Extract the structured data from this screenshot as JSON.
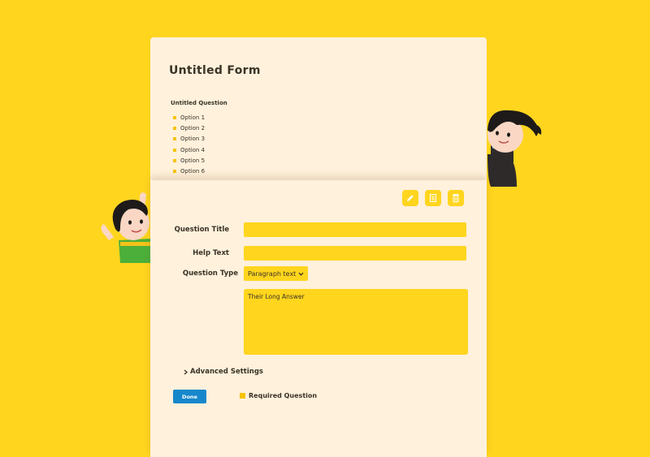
{
  "colors": {
    "background": "#FFD51E",
    "card": "#FFF1DC",
    "field": "#FFD51E",
    "primary_button": "#1787CC",
    "text": "#3a3326"
  },
  "form": {
    "title": "Untitled Form",
    "question": {
      "title": "Untitled Question",
      "options": [
        "Option 1",
        "Option 2",
        "Option 3",
        "Option 4",
        "Option 5",
        "Option 6"
      ]
    }
  },
  "toolbar": {
    "icons": [
      "pencil-icon",
      "copy-icon",
      "trash-icon"
    ]
  },
  "editor": {
    "question_title_label": "Question Title",
    "question_title_value": "",
    "help_text_label": "Help Text",
    "help_text_value": "",
    "question_type_label": "Question Type",
    "question_type_selected": "Paragraph text",
    "answer_placeholder": "Their Long Answer",
    "advanced_settings": "Advanced Settings",
    "done_label": "Done",
    "required_label": "Required Question"
  }
}
